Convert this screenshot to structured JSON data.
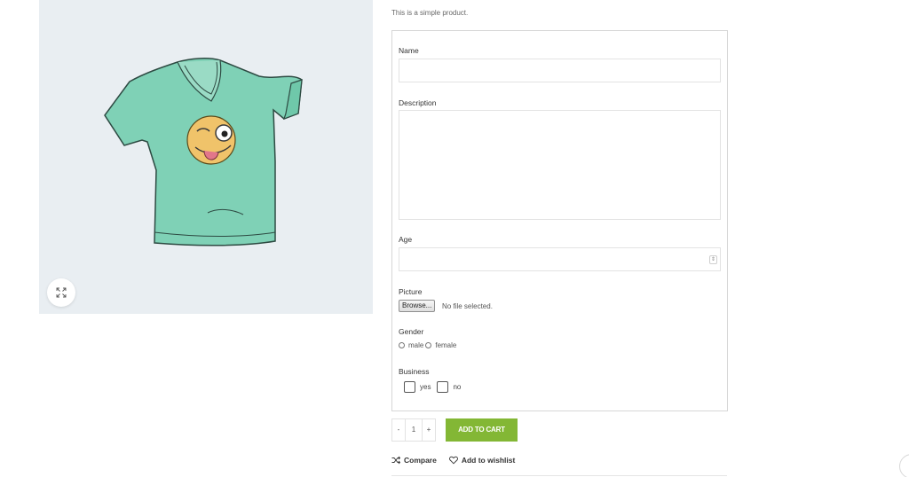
{
  "product": {
    "short_description": "This is a simple product."
  },
  "form": {
    "name_label": "Name",
    "name_value": "",
    "description_label": "Description",
    "description_value": "",
    "age_label": "Age",
    "age_value": "",
    "picture_label": "Picture",
    "browse_label": "Browse...",
    "no_file_text": "No file selected.",
    "gender_label": "Gender",
    "gender_options": [
      "male",
      "female"
    ],
    "business_label": "Business",
    "business_options": [
      "yes",
      "no"
    ]
  },
  "cart": {
    "minus": "-",
    "quantity": "1",
    "plus": "+",
    "add_to_cart_label": "ADD TO CART",
    "accent_color": "#83b735"
  },
  "actions": {
    "compare_label": "Compare",
    "wishlist_label": "Add to wishlist"
  },
  "icons": {
    "zoom": "expand-icon",
    "compare": "shuffle-icon",
    "wishlist": "heart-icon"
  }
}
